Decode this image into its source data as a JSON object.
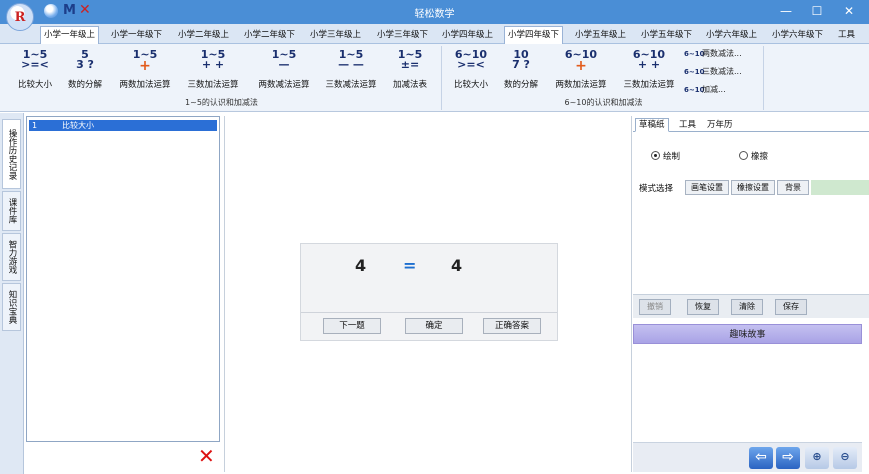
{
  "window": {
    "title": "轻松数学",
    "quick_access": {
      "m_label": "M",
      "x_label": "✕"
    },
    "controls": {
      "minimize": "—",
      "maximize": "☐",
      "close": "✕"
    },
    "logo_text": "R"
  },
  "grade_tabs": [
    "小学一年级上",
    "小学一年级下",
    "小学二年级上",
    "小学二年级下",
    "小学三年级上",
    "小学三年级下",
    "小学四年级上",
    "小学四年级下",
    "小学五年级上",
    "小学五年级下",
    "小学六年级上",
    "小学六年级下",
    "工具"
  ],
  "ribbon": {
    "group1": {
      "label": "1~5的认识和加减法",
      "buttons": [
        {
          "top": "1~5",
          "bottom": ">=<",
          "label": "比较大小"
        },
        {
          "top": "5",
          "bottom": "3  ?",
          "label": "数的分解"
        },
        {
          "top": "1~5",
          "bottom": "+",
          "label": "两数加法运算"
        },
        {
          "top": "1~5",
          "bottom": "+ +",
          "label": "三数加法运算"
        },
        {
          "top": "1~5",
          "bottom": "—",
          "label": "两数减法运算"
        },
        {
          "top": "1~5",
          "bottom": "— —",
          "label": "三数减法运算"
        },
        {
          "top": "1~5",
          "bottom": "±=",
          "label": "加减法表"
        }
      ]
    },
    "group2": {
      "label": "6~10的认识和加减法",
      "buttons": [
        {
          "top": "6~10",
          "bottom": ">=<",
          "label": "比较大小"
        },
        {
          "top": "10",
          "bottom": "7  ?",
          "label": "数的分解"
        },
        {
          "top": "6~10",
          "bottom": "+",
          "label": "两数加法运算"
        },
        {
          "top": "6~10",
          "bottom": "+ +",
          "label": "三数加法运算"
        }
      ],
      "small_buttons": [
        {
          "icon": "6~10",
          "label": "两数减法..."
        },
        {
          "icon": "6~10",
          "label": "三数减法..."
        },
        {
          "icon": "6~10",
          "label": "加减..."
        }
      ]
    }
  },
  "side_tabs": [
    "操作历史记录",
    "课件库",
    "智力游戏",
    "知识宝典"
  ],
  "history": {
    "items": [
      {
        "num": "1",
        "text": "比较大小"
      }
    ],
    "delete_icon": "✕"
  },
  "quiz": {
    "left": "4",
    "operator": "=",
    "right": "4",
    "buttons": {
      "next": "下一题",
      "confirm": "确定",
      "answer": "正确答案"
    }
  },
  "right_panel": {
    "tabs": [
      "草稿纸",
      "工具",
      "万年历"
    ],
    "radios": {
      "draw": "绘制",
      "erase": "橡擦"
    },
    "mode": {
      "label": "模式选择",
      "buttons": [
        "画笔设置",
        "橡擦设置",
        "背景"
      ]
    },
    "actions": {
      "undo": "撤销",
      "redo": "恢复",
      "clear": "清除",
      "save": "保存"
    },
    "story_label": "趣味故事",
    "nav": {
      "back": "⇦",
      "forward": "⇨",
      "zoom_in": "⊕",
      "zoom_out": "⊖"
    }
  },
  "colors": {
    "titlebar": "#4a8ed6",
    "selection": "#2b6fd6",
    "story": "#b5afe9"
  }
}
